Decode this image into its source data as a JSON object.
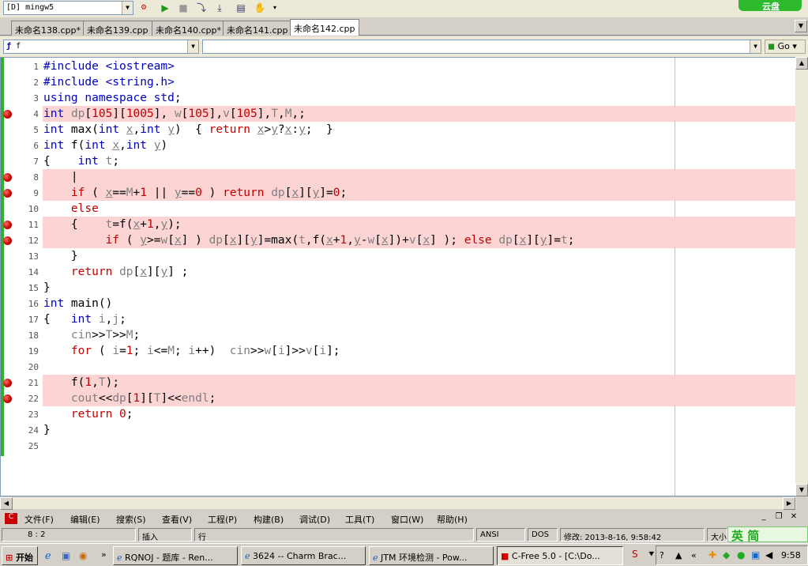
{
  "toolbar": {
    "compiler": "[D] mingw5",
    "cloud_label": "云盘"
  },
  "tabs": [
    "未命名138.cpp*",
    "未命名139.cpp",
    "未命名140.cpp*",
    "未命名141.cpp",
    "未命名142.cpp"
  ],
  "active_tab": 4,
  "funcbar": {
    "function_value": "f",
    "go_label": "Go"
  },
  "code_lines": [
    {
      "n": "1",
      "bp": false,
      "html": "<span class='kw'>#include</span> <span class='kw'>&lt;iostream&gt;</span>"
    },
    {
      "n": "2",
      "bp": false,
      "html": "<span class='kw'>#include</span> <span class='kw'>&lt;string.h&gt;</span>"
    },
    {
      "n": "3",
      "bp": false,
      "html": "<span class='kw'>using namespace std</span>;"
    },
    {
      "n": "4",
      "bp": true,
      "html": "<span class='kw'>int</span> <span class='gy'>dp</span>[<span class='rd'>105</span>][<span class='rd'>1005</span>], <span class='gy'>w</span>[<span class='rd'>105</span>],<span class='gy'>v</span>[<span class='rd'>105</span>],<span class='gy'>T</span>,<span class='gy'>M</span>,;"
    },
    {
      "n": "5",
      "bp": false,
      "html": "<span class='kw'>int</span> max(<span class='kw'>int</span> <span class='gy u'>x</span>,<span class='kw'>int</span> <span class='gy u'>y</span>)  { <span class='rd'>return</span> <span class='gy u'>x</span>&gt;<span class='gy u'>y</span>?<span class='gy u'>x</span>:<span class='gy u'>y</span>;  }"
    },
    {
      "n": "6",
      "bp": false,
      "html": "<span class='kw'>int</span> f(<span class='kw'>int</span> <span class='gy u'>x</span>,<span class='kw'>int</span> <span class='gy u'>y</span>)"
    },
    {
      "n": "7",
      "bp": false,
      "html": "{    <span class='kw'>int</span> <span class='gy'>t</span>;"
    },
    {
      "n": "8",
      "bp": true,
      "html": "    |"
    },
    {
      "n": "9",
      "bp": true,
      "html": "    <span class='rd'>if</span> ( <span class='gy u'>x</span>==<span class='gy'>M</span>+<span class='rd'>1</span> || <span class='gy u'>y</span>==<span class='rd'>0</span> ) <span class='rd'>return</span> <span class='gy'>dp</span>[<span class='gy u'>x</span>][<span class='gy u'>y</span>]=<span class='rd'>0</span>;"
    },
    {
      "n": "10",
      "bp": false,
      "html": "    <span class='rd'>else</span>"
    },
    {
      "n": "11",
      "bp": true,
      "html": "    {    <span class='gy'>t</span>=f(<span class='gy u'>x</span>+<span class='rd'>1</span>,<span class='gy u'>y</span>);"
    },
    {
      "n": "12",
      "bp": true,
      "html": "         <span class='rd'>if</span> ( <span class='gy u'>y</span>&gt;=<span class='gy'>w</span>[<span class='gy u'>x</span>] ) <span class='gy'>dp</span>[<span class='gy u'>x</span>][<span class='gy u'>y</span>]=max(<span class='gy'>t</span>,f(<span class='gy u'>x</span>+<span class='rd'>1</span>,<span class='gy u'>y</span>-<span class='gy'>w</span>[<span class='gy u'>x</span>])+<span class='gy'>v</span>[<span class='gy u'>x</span>] ); <span class='rd'>else</span> <span class='gy'>dp</span>[<span class='gy u'>x</span>][<span class='gy u'>y</span>]=<span class='gy'>t</span>;"
    },
    {
      "n": "13",
      "bp": false,
      "html": "    }"
    },
    {
      "n": "14",
      "bp": false,
      "html": "    <span class='rd'>return</span> <span class='gy'>dp</span>[<span class='gy u'>x</span>][<span class='gy u'>y</span>] ;"
    },
    {
      "n": "15",
      "bp": false,
      "html": "}"
    },
    {
      "n": "16",
      "bp": false,
      "html": "<span class='kw'>int</span> main()"
    },
    {
      "n": "17",
      "bp": false,
      "html": "{   <span class='kw'>int</span> <span class='gy'>i</span>,<span class='gy'>j</span>;"
    },
    {
      "n": "18",
      "bp": false,
      "html": "    <span class='gy'>cin</span>&gt;&gt;<span class='gy'>T</span>&gt;&gt;<span class='gy'>M</span>;"
    },
    {
      "n": "19",
      "bp": false,
      "html": "    <span class='rd'>for</span> ( <span class='gy'>i</span>=<span class='rd'>1</span>; <span class='gy'>i</span>&lt;=<span class='gy'>M</span>; <span class='gy'>i</span>++)  <span class='gy'>cin</span>&gt;&gt;<span class='gy'>w</span>[<span class='gy'>i</span>]&gt;&gt;<span class='gy'>v</span>[<span class='gy'>i</span>];"
    },
    {
      "n": "20",
      "bp": false,
      "html": ""
    },
    {
      "n": "21",
      "bp": true,
      "html": "    f(<span class='rd'>1</span>,<span class='gy'>T</span>);"
    },
    {
      "n": "22",
      "bp": true,
      "html": "    <span class='gy'>cout</span>&lt;&lt;<span class='gy'>dp</span>[<span class='rd'>1</span>][<span class='gy'>T</span>]&lt;&lt;<span class='gy'>endl</span>;"
    },
    {
      "n": "23",
      "bp": false,
      "html": "    <span class='rd'>return</span> <span class='rd'>0</span>;"
    },
    {
      "n": "24",
      "bp": false,
      "html": "}"
    },
    {
      "n": "25",
      "bp": false,
      "html": ""
    }
  ],
  "menu": [
    "文件(F)",
    "编辑(E)",
    "搜索(S)",
    "查看(V)",
    "工程(P)",
    "构建(B)",
    "调试(D)",
    "工具(T)",
    "窗口(W)",
    "帮助(H)"
  ],
  "status": {
    "position": "8 : 2",
    "insert": "插入",
    "mode": "行",
    "encoding": "ANSI",
    "lineend": "DOS",
    "modified": "修改: 2013-8-16, 9:58:42",
    "size": "大小"
  },
  "taskbar": {
    "start": "开始",
    "items": [
      "RQNOJ - 题库 - Ren...",
      "3624 -- Charm Brac...",
      "JTM 环境检测 - Pow...",
      "C-Free 5.0 - [C:\\Do..."
    ],
    "active": 3,
    "clock": "9:58",
    "ime": "英 简"
  }
}
